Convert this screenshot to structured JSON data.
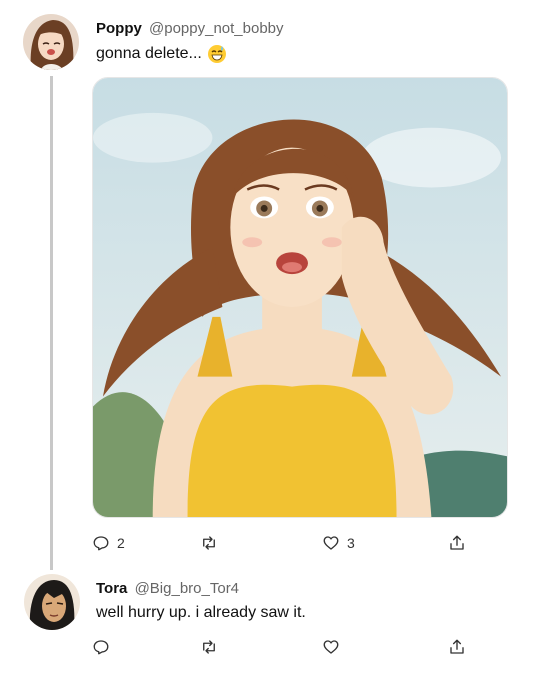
{
  "posts": [
    {
      "display_name": "Poppy",
      "handle": "@poppy_not_bobby",
      "text": "gonna delete...",
      "emoji": "grinning-sweat-emoji",
      "avatar": "woman-avatar",
      "media": "anime-woman-yellow-top-illustration",
      "reply_count": "2",
      "retweet_count": "",
      "like_count": "3"
    },
    {
      "display_name": "Tora",
      "handle": "@Big_bro_Tor4",
      "text": "well hurry up. i already saw it.",
      "avatar": "man-avatar",
      "reply_count": "",
      "retweet_count": "",
      "like_count": ""
    }
  ],
  "icons": {
    "reply": "reply-icon",
    "retweet": "retweet-icon",
    "like": "heart-icon",
    "share": "share-icon"
  },
  "colors": {
    "thread_line": "#c8c8c8",
    "icon": "#333333",
    "handle": "#666666"
  }
}
